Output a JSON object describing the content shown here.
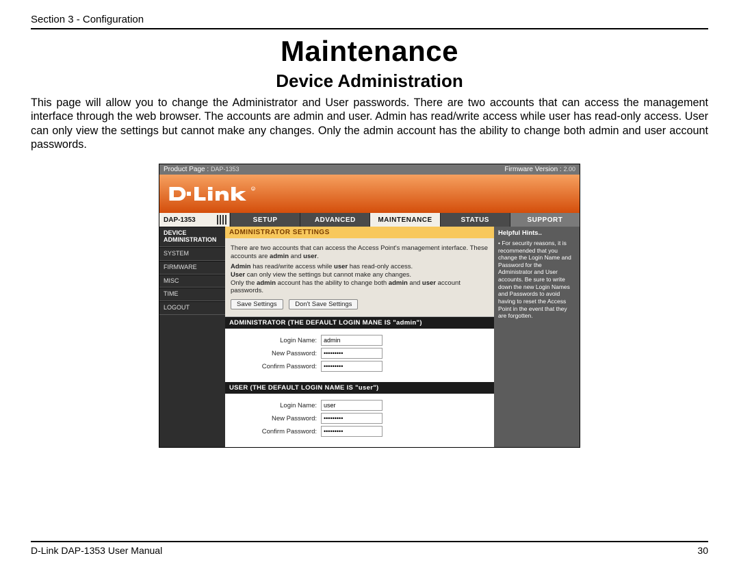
{
  "doc": {
    "section_header": "Section 3 - Configuration",
    "title": "Maintenance",
    "subtitle": "Device Administration",
    "paragraph": "This page will allow you to change the Administrator and User passwords. There are two accounts that can access the management interface through the web browser. The accounts are admin and user. Admin has read/write access while user has read-only access. User can only view the settings but cannot make any changes. Only the admin account has the ability to change both admin and user account passwords.",
    "footer_left": "D-Link DAP-1353 User Manual",
    "footer_right": "30"
  },
  "ui": {
    "topbar": {
      "product_label": "Product Page :",
      "product_model": "DAP-1353",
      "fw_label": "Firmware Version :",
      "fw_version": "2.00"
    },
    "brand_text": "D-Link",
    "model_cell": "DAP-1353",
    "tabs": {
      "setup": "SETUP",
      "advanced": "ADVANCED",
      "maintenance": "MAINTENANCE",
      "status": "STATUS",
      "support": "SUPPORT"
    },
    "sidebar": {
      "device_admin": "DEVICE ADMINISTRATION",
      "system": "SYSTEM",
      "firmware": "FIRMWARE",
      "misc": "MISC",
      "time": "TIME",
      "logout": "LOGOUT"
    },
    "panel": {
      "yellow_header": "ADMINISTRATOR SETTINGS",
      "info_line1_a": "There are two accounts that can access the Access Point's management interface. These accounts are ",
      "info_line1_b": "admin",
      "info_line1_c": " and ",
      "info_line1_d": "user",
      "info_line1_e": ".",
      "info_line2_a": "Admin",
      "info_line2_b": " has read/write access while ",
      "info_line2_c": "user",
      "info_line2_d": " has read-only access.",
      "info_line3_a": "User",
      "info_line3_b": " can only view the settings but cannot make any changes.",
      "info_line4_a": "Only the ",
      "info_line4_b": "admin",
      "info_line4_c": " account has the ability to change both ",
      "info_line4_d": "admin",
      "info_line4_e": " and ",
      "info_line4_f": "user",
      "info_line4_g": " account passwords.",
      "save_btn": "Save Settings",
      "dont_save_btn": "Don't Save Settings",
      "admin_bar": "ADMINISTRATOR (THE DEFAULT LOGIN MANE IS \"admin\")",
      "user_bar": "USER (THE DEFAULT LOGIN NAME IS \"user\")",
      "login_name_label": "Login Name:",
      "new_pw_label": "New Password:",
      "confirm_pw_label": "Confirm Password:",
      "admin_login": "admin",
      "user_login": "user",
      "pw_mask": "•••••••••"
    },
    "hints": {
      "header": "Helpful Hints..",
      "bullet": "•",
      "text": "For security reasons, it is recommended that you change the Login Name and Password for the Administrator and User accounts. Be sure to write down the new Login Names and Passwords to avoid having to reset the Access Point in the event that they are forgotten."
    }
  }
}
